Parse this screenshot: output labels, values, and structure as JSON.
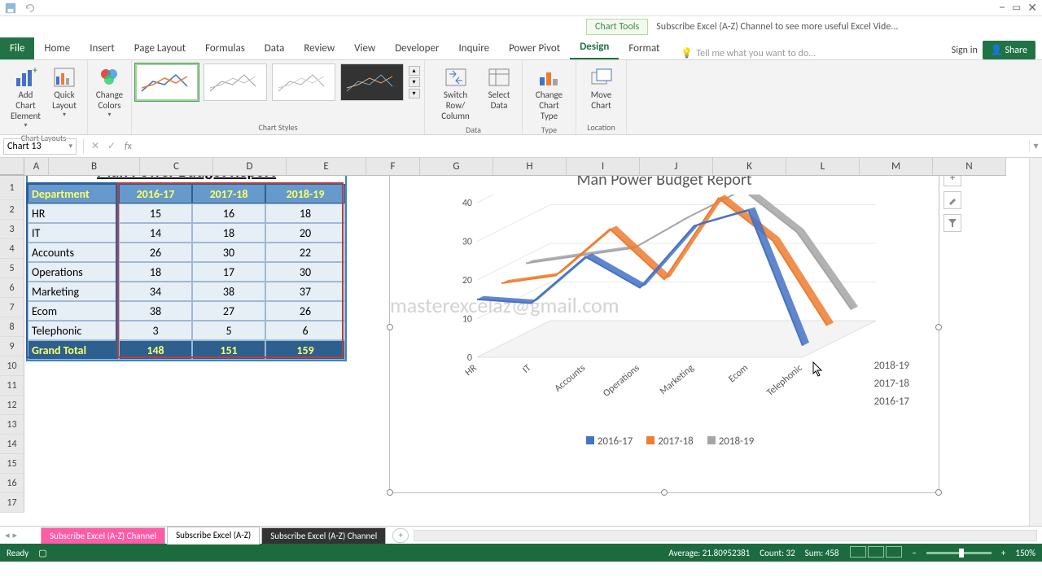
{
  "app": {
    "chart_tools": "Chart Tools",
    "title": "Subscribe Excel (A-Z) Channel to see more useful Excel Vide..."
  },
  "tabs": {
    "file": "File",
    "home": "Home",
    "insert": "Insert",
    "page_layout": "Page Layout",
    "formulas": "Formulas",
    "data": "Data",
    "review": "Review",
    "view": "View",
    "developer": "Developer",
    "inquire": "Inquire",
    "power_pivot": "Power Pivot",
    "design": "Design",
    "format": "Format",
    "tell_me": "Tell me what you want to do...",
    "sign_in": "Sign in",
    "share": "Share"
  },
  "ribbon": {
    "add_element": "Add Chart\nElement",
    "quick_layout": "Quick\nLayout",
    "layouts_label": "Chart Layouts",
    "change_colors": "Change\nColors",
    "styles_label": "Chart Styles",
    "switch": "Switch Row/\nColumn",
    "select_data": "Select\nData",
    "data_label": "Data",
    "change_type": "Change\nChart Type",
    "type_label": "Type",
    "move_chart": "Move\nChart",
    "location_label": "Location"
  },
  "namebox": "Chart 13",
  "table": {
    "title": "Man Power Budget Report",
    "headers": [
      "Department",
      "2016-17",
      "2017-18",
      "2018-19"
    ],
    "rows": [
      [
        "HR",
        15,
        16,
        18
      ],
      [
        "IT",
        14,
        18,
        20
      ],
      [
        "Accounts",
        26,
        30,
        22
      ],
      [
        "Operations",
        18,
        17,
        30
      ],
      [
        "Marketing",
        34,
        38,
        37
      ],
      [
        "Ecom",
        38,
        27,
        26
      ],
      [
        "Telephonic",
        3,
        5,
        6
      ]
    ],
    "total": [
      "Grand Total",
      148,
      151,
      159
    ]
  },
  "chart_data": {
    "type": "line",
    "title": "Man Power Budget Report",
    "categories": [
      "HR",
      "IT",
      "Accounts",
      "Operations",
      "Marketing",
      "Ecom",
      "Telephonic"
    ],
    "series": [
      {
        "name": "2016-17",
        "color": "#4472c4",
        "values": [
          15,
          14,
          26,
          18,
          34,
          38,
          3
        ]
      },
      {
        "name": "2017-18",
        "color": "#ed7d31",
        "values": [
          16,
          18,
          30,
          17,
          38,
          27,
          5
        ]
      },
      {
        "name": "2018-19",
        "color": "#a5a5a5",
        "values": [
          18,
          20,
          22,
          30,
          37,
          26,
          6
        ]
      }
    ],
    "ylabel": "",
    "xlabel": "",
    "yticks": [
      0,
      10,
      20,
      30,
      40
    ],
    "ylim": [
      0,
      40
    ],
    "side_legend": [
      "2018-19",
      "2017-18",
      "2016-17"
    ]
  },
  "watermark": "masterexcelaz@gmail.com",
  "sheet_tabs": {
    "tab1": "Subscribe Excel (A-Z) Channel",
    "tab2": "Subscribe Excel (A-Z)",
    "tab3": "Subscribe Excel (A-Z) Channel"
  },
  "status": {
    "ready": "Ready",
    "avg": "Average: 21.80952381",
    "count": "Count: 32",
    "sum": "Sum: 458",
    "zoom": "150%"
  }
}
